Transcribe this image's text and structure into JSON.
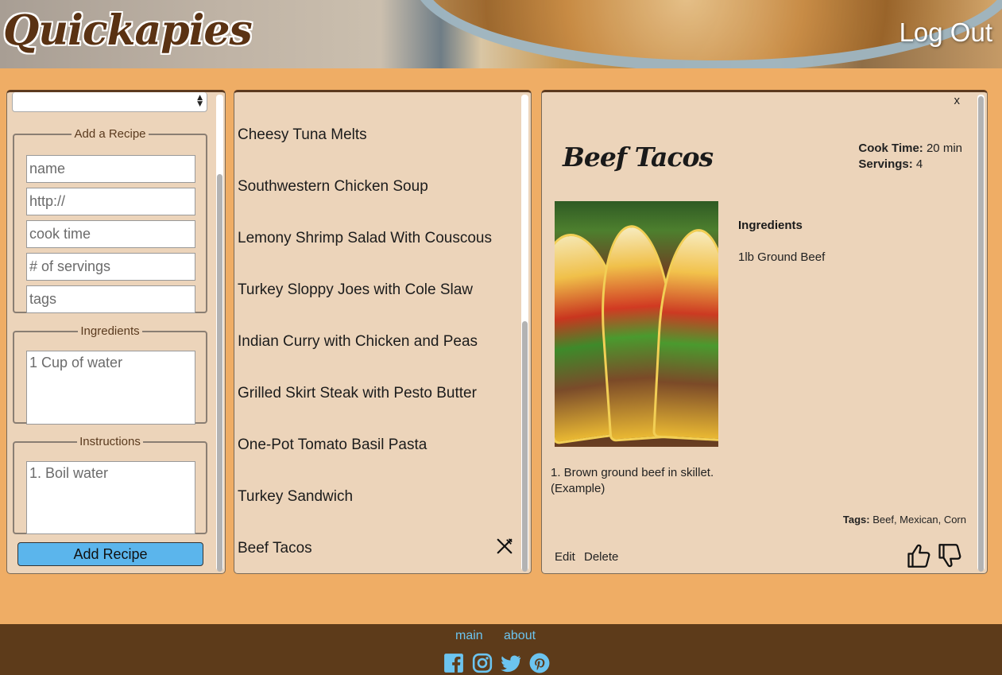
{
  "header": {
    "logo": "Quickapies",
    "logout_label": "Log Out"
  },
  "form": {
    "select_value": "",
    "legend_add": "Add a Recipe",
    "name_placeholder": "name",
    "url_placeholder": "http://",
    "cook_time_placeholder": "cook time",
    "servings_placeholder": "# of servings",
    "tags_placeholder": "tags",
    "legend_ingredients": "Ingredients",
    "ingredients_placeholder": "1 Cup of water",
    "legend_instructions": "Instructions",
    "instructions_placeholder": "1. Boil water",
    "add_button": "Add Recipe"
  },
  "recipes": [
    "Cheesy Tuna Melts",
    "Southwestern Chicken Soup",
    "Lemony Shrimp Salad With Couscous",
    "Turkey Sloppy Joes with Cole Slaw",
    "Indian Curry with Chicken and Peas",
    "Grilled Skirt Steak with Pesto Butter",
    "One-Pot Tomato Basil Pasta",
    "Turkey Sandwich",
    "Beef Tacos"
  ],
  "detail": {
    "close": "x",
    "title": "Beef Tacos",
    "cook_time_label": "Cook Time:",
    "cook_time_value": "20 min",
    "servings_label": "Servings:",
    "servings_value": "4",
    "ingredients_title": "Ingredients",
    "ingredients": [
      "1lb Ground Beef"
    ],
    "instructions_line1": "1. Brown ground beef in skillet.",
    "instructions_line2": "(Example)",
    "tags_label": "Tags:",
    "tags_value": "Beef, Mexican, Corn",
    "edit": "Edit",
    "delete": "Delete"
  },
  "footer": {
    "main": "main",
    "about": "about",
    "icons": [
      "facebook-icon",
      "instagram-icon",
      "twitter-icon",
      "pinterest-icon"
    ],
    "icon_color": "#6cc4ef"
  }
}
